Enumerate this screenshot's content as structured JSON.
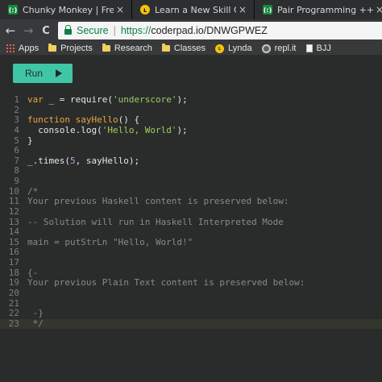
{
  "tabs": [
    {
      "title": "Chunky Monkey | Free C",
      "favicon": "freecodecamp-icon",
      "close": "×"
    },
    {
      "title": "Learn a New Skill Online",
      "favicon": "lynda-icon",
      "close": "×"
    },
    {
      "title": "Pair Programming ++ - C",
      "favicon": "coderpad-icon",
      "close": "×"
    }
  ],
  "address_bar": {
    "back": "←",
    "forward": "→",
    "reload": "C",
    "secure_label": "Secure",
    "url_protocol": "https://",
    "url_rest": "coderpad.io/DNWGPWEZ"
  },
  "bookmarks": [
    {
      "label": "Apps",
      "icon": "apps-grid-icon"
    },
    {
      "label": "Projects",
      "icon": "folder-icon"
    },
    {
      "label": "Research",
      "icon": "folder-icon"
    },
    {
      "label": "Classes",
      "icon": "folder-icon"
    },
    {
      "label": "Lynda",
      "icon": "lynda-icon"
    },
    {
      "label": "repl.it",
      "icon": "replit-icon"
    },
    {
      "label": "BJJ",
      "icon": "document-icon"
    }
  ],
  "run_button": {
    "label": "Run",
    "icon": "play-icon"
  },
  "colors": {
    "accent": "#3fc6a5",
    "keyword": "#f0a23c",
    "string": "#9fcc5e",
    "number": "#ce93e4",
    "comment": "#8a8a86",
    "background": "#2a2c2b"
  },
  "editor": {
    "active_line": 23,
    "lines": [
      {
        "n": "1",
        "tokens": [
          {
            "t": "kw",
            "v": "var"
          },
          {
            "t": "tx",
            "v": " _ = require("
          },
          {
            "t": "str",
            "v": "'underscore'"
          },
          {
            "t": "tx",
            "v": ");"
          }
        ]
      },
      {
        "n": "2",
        "tokens": []
      },
      {
        "n": "3",
        "tokens": [
          {
            "t": "kw",
            "v": "function"
          },
          {
            "t": "tx",
            "v": " "
          },
          {
            "t": "fn",
            "v": "sayHello"
          },
          {
            "t": "tx",
            "v": "() {"
          }
        ]
      },
      {
        "n": "4",
        "tokens": [
          {
            "t": "tx",
            "v": "  console.log("
          },
          {
            "t": "str",
            "v": "'Hello, World'"
          },
          {
            "t": "tx",
            "v": ");"
          }
        ]
      },
      {
        "n": "5",
        "tokens": [
          {
            "t": "tx",
            "v": "}"
          }
        ]
      },
      {
        "n": "6",
        "tokens": []
      },
      {
        "n": "7",
        "tokens": [
          {
            "t": "tx",
            "v": "_.times("
          },
          {
            "t": "num",
            "v": "5"
          },
          {
            "t": "tx",
            "v": ", sayHello);"
          }
        ]
      },
      {
        "n": "8",
        "tokens": []
      },
      {
        "n": "9",
        "tokens": []
      },
      {
        "n": "10",
        "tokens": [
          {
            "t": "cm",
            "v": "/*"
          }
        ]
      },
      {
        "n": "11",
        "tokens": [
          {
            "t": "cm",
            "v": "Your previous Haskell content is preserved below:"
          }
        ]
      },
      {
        "n": "12",
        "tokens": []
      },
      {
        "n": "13",
        "tokens": [
          {
            "t": "cm",
            "v": "-- Solution will run in Haskell Interpreted Mode"
          }
        ]
      },
      {
        "n": "14",
        "tokens": []
      },
      {
        "n": "15",
        "tokens": [
          {
            "t": "cm",
            "v": "main = putStrLn \"Hello, World!\""
          }
        ]
      },
      {
        "n": "16",
        "tokens": []
      },
      {
        "n": "17",
        "tokens": []
      },
      {
        "n": "18",
        "tokens": [
          {
            "t": "cm",
            "v": "{-"
          }
        ]
      },
      {
        "n": "19",
        "tokens": [
          {
            "t": "cm",
            "v": "Your previous Plain Text content is preserved below:"
          }
        ]
      },
      {
        "n": "20",
        "tokens": []
      },
      {
        "n": "21",
        "tokens": []
      },
      {
        "n": "22",
        "tokens": [
          {
            "t": "cm",
            "v": " -}"
          }
        ]
      },
      {
        "n": "23",
        "tokens": [
          {
            "t": "cm",
            "v": " */"
          }
        ]
      }
    ]
  }
}
